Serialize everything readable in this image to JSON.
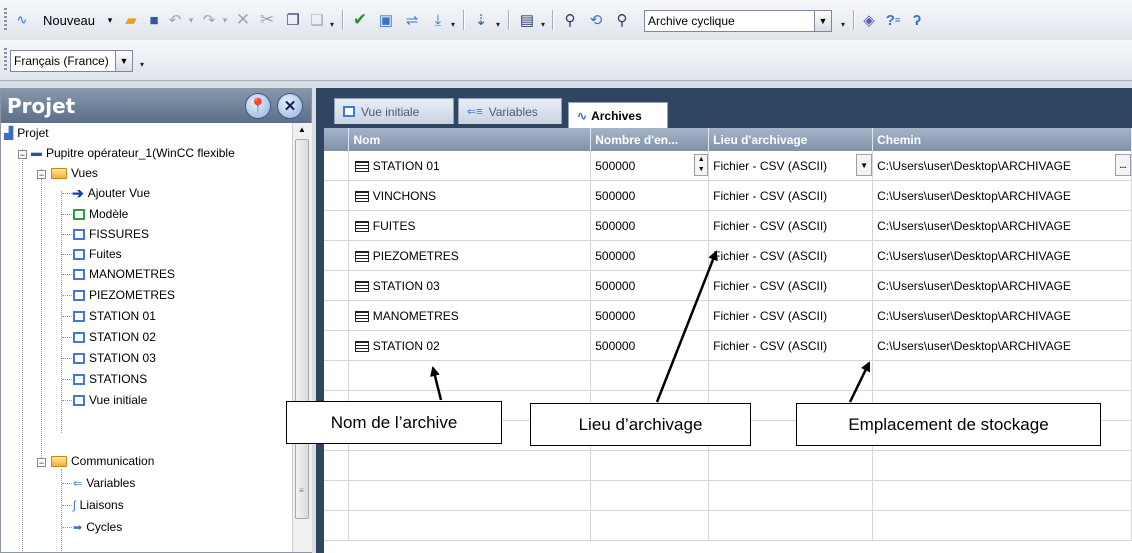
{
  "toolbar": {
    "new_label": "Nouveau",
    "object_dropdown": "Archive cyclique",
    "language_dropdown": "Français (France)",
    "help_glyph": "?",
    "icons": [
      "new-icon",
      "open-icon",
      "save-icon",
      "undo-icon",
      "redo-icon",
      "delete-icon",
      "cut-icon",
      "copy-icon",
      "paste-icon",
      "check-icon",
      "compile-icon",
      "transfer-icon",
      "download-icon",
      "print-icon",
      "cross-reference-icon",
      "find-icon",
      "replace-icon",
      "find-next-icon",
      "help-book-icon",
      "help-icon",
      "whats-this-icon"
    ]
  },
  "project": {
    "title": "Projet",
    "tree": [
      {
        "label": "Projet",
        "icon": "project-icon",
        "level": 0
      },
      {
        "label": "Pupitre opérateur_1(WinCC flexible",
        "icon": "hmi-device-icon",
        "level": 1
      },
      {
        "label": "Vues",
        "icon": "folder-icon",
        "level": 2
      },
      {
        "label": "Ajouter Vue",
        "icon": "add-screen-icon",
        "level": 3
      },
      {
        "label": "Modèle",
        "icon": "template-icon",
        "level": 3
      },
      {
        "label": "FISSURES",
        "icon": "screen-icon",
        "level": 3
      },
      {
        "label": "Fuites",
        "icon": "screen-icon",
        "level": 3
      },
      {
        "label": "MANOMETRES",
        "icon": "screen-icon",
        "level": 3
      },
      {
        "label": "PIEZOMETRES",
        "icon": "screen-icon",
        "level": 3
      },
      {
        "label": "STATION 01",
        "icon": "screen-icon",
        "level": 3
      },
      {
        "label": "STATION 02",
        "icon": "screen-icon",
        "level": 3
      },
      {
        "label": "STATION 03",
        "icon": "screen-icon",
        "level": 3
      },
      {
        "label": "STATIONS",
        "icon": "screen-icon",
        "level": 3
      },
      {
        "label": "Vue initiale",
        "icon": "screen-icon",
        "level": 3
      },
      {
        "label": "Communication",
        "icon": "folder-icon",
        "level": 2
      },
      {
        "label": "Variables",
        "icon": "variables-icon",
        "level": 3
      },
      {
        "label": "Liaisons",
        "icon": "connections-icon",
        "level": 3
      },
      {
        "label": "Cycles",
        "icon": "cycles-icon",
        "level": 3
      }
    ]
  },
  "editor": {
    "tabs": [
      {
        "label": "Vue initiale",
        "icon": "screen-icon",
        "active": false
      },
      {
        "label": "Variables",
        "icon": "variables-icon",
        "active": false
      },
      {
        "label": "Archives",
        "icon": "archive-icon",
        "active": true
      }
    ],
    "columns": [
      "Nom",
      "Nombre d'en...",
      "Lieu d'archivage",
      "Chemin"
    ],
    "rows": [
      {
        "name": "STATION 01",
        "count": "500000",
        "location": "Fichier - CSV (ASCII)",
        "path": "C:\\Users\\user\\Desktop\\ARCHIVAGE",
        "ellipsis": "..."
      },
      {
        "name": "VINCHONS",
        "count": "500000",
        "location": "Fichier - CSV (ASCII)",
        "path": "C:\\Users\\user\\Desktop\\ARCHIVAGE"
      },
      {
        "name": "FUITES",
        "count": "500000",
        "location": "Fichier - CSV (ASCII)",
        "path": "C:\\Users\\user\\Desktop\\ARCHIVAGE"
      },
      {
        "name": "PIEZOMETRES",
        "count": "500000",
        "location": "Fichier - CSV (ASCII)",
        "path": "C:\\Users\\user\\Desktop\\ARCHIVAGE"
      },
      {
        "name": "STATION 03",
        "count": "500000",
        "location": "Fichier - CSV (ASCII)",
        "path": "C:\\Users\\user\\Desktop\\ARCHIVAGE"
      },
      {
        "name": "MANOMETRES",
        "count": "500000",
        "location": "Fichier - CSV (ASCII)",
        "path": "C:\\Users\\user\\Desktop\\ARCHIVAGE"
      },
      {
        "name": "STATION 02",
        "count": "500000",
        "location": "Fichier - CSV (ASCII)",
        "path": "C:\\Users\\user\\Desktop\\ARCHIVAGE"
      }
    ]
  },
  "annotations": {
    "name": "Nom de l’archive",
    "location": "Lieu d’archivage",
    "storage": "Emplacement de stockage"
  },
  "colors": {
    "panel_header": "#6d7f99",
    "grid_header": "#8fa0b7",
    "editor_background": "#2f4561"
  }
}
